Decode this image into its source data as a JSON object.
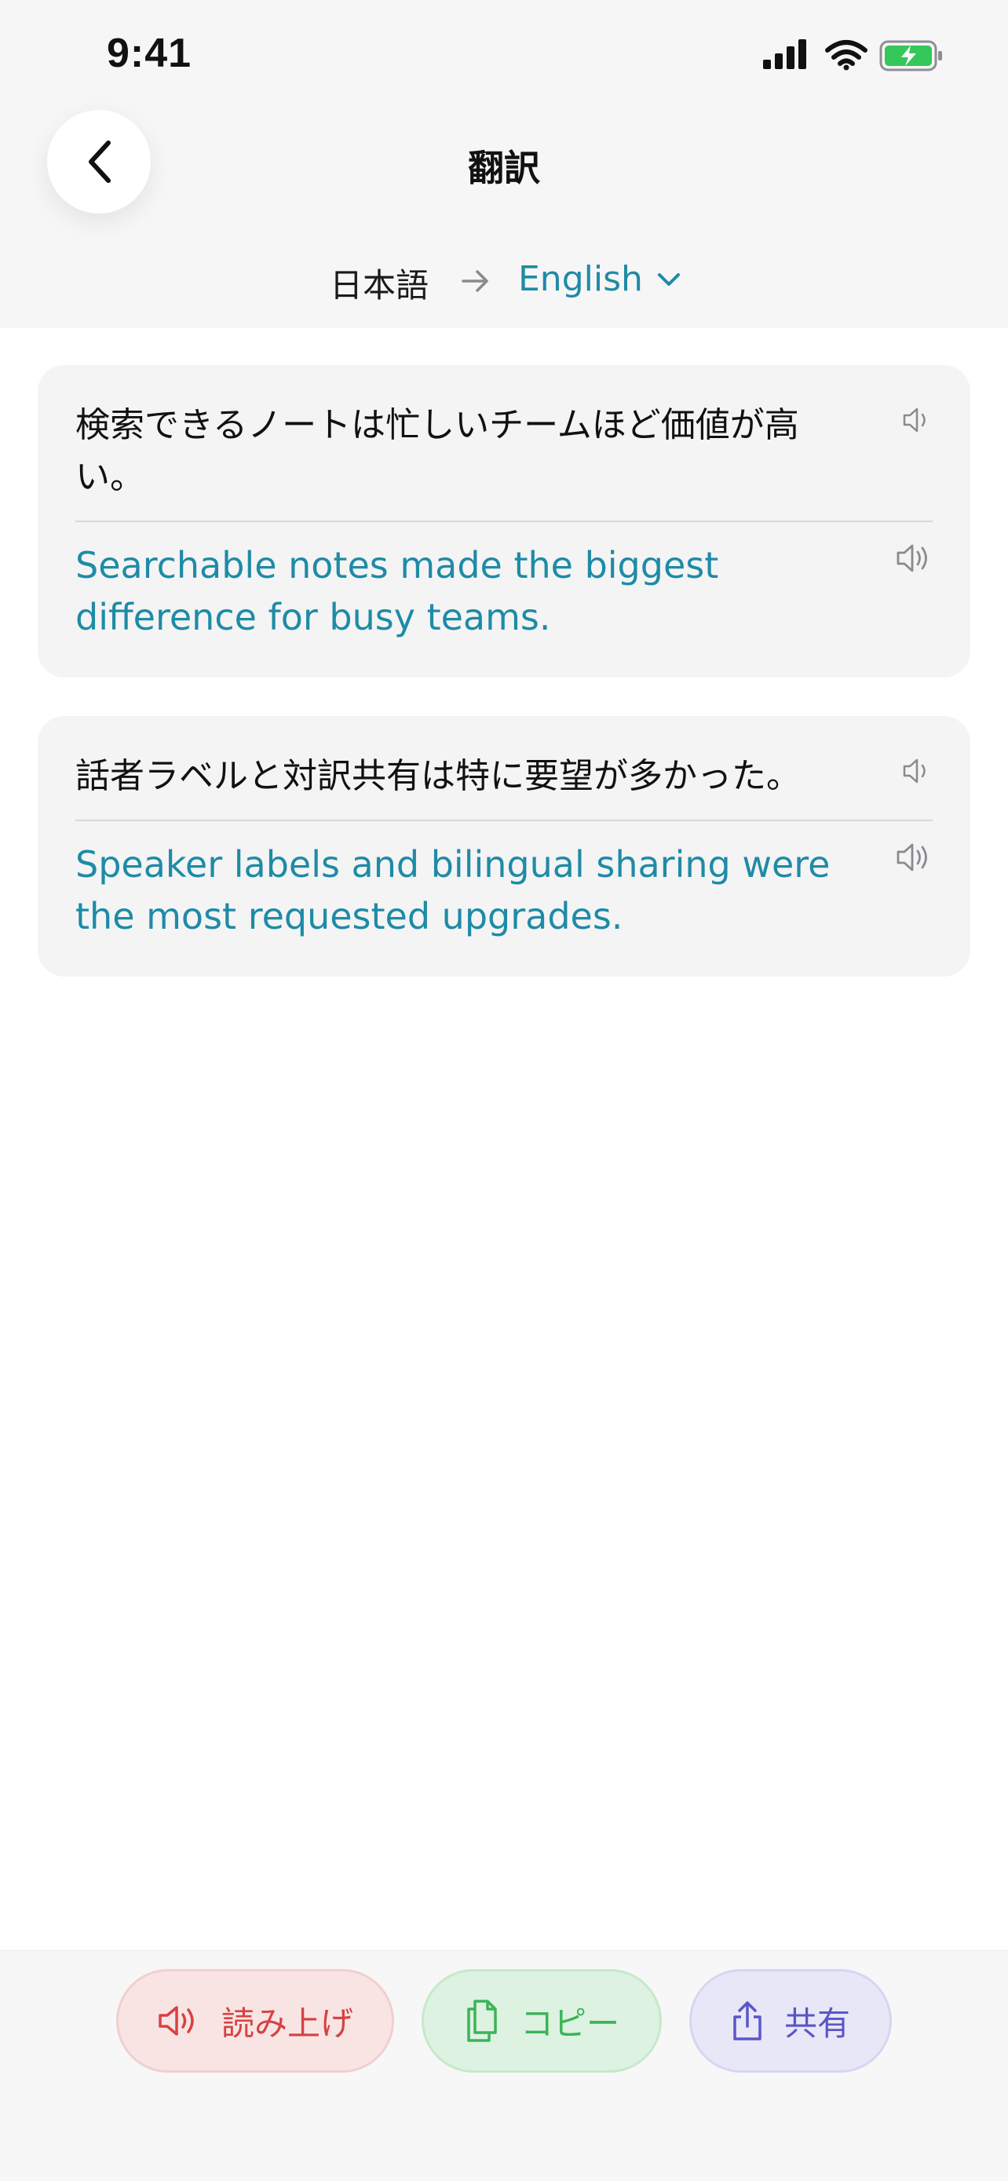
{
  "status_bar": {
    "time": "9:41"
  },
  "header": {
    "title": "翻訳",
    "source_language": "日本語",
    "target_language": "English"
  },
  "translations": [
    {
      "source": "検索できるノートは忙しいチームほど価値が高い。",
      "target": "Searchable notes made the biggest difference for busy teams."
    },
    {
      "source": "話者ラベルと対訳共有は特に要望が多かった。",
      "target": "Speaker labels and bilingual sharing were the most requested upgrades."
    }
  ],
  "actions": {
    "read_aloud": "読み上げ",
    "copy": "コピー",
    "share": "共有"
  },
  "colors": {
    "accent": "#1e8ba6",
    "read_aloud": "#d64242",
    "copy": "#3cb35a",
    "share": "#5b56c6",
    "battery": "#34c759"
  },
  "icons": {
    "back": "chevron-left-icon",
    "arrow": "arrow-right-icon",
    "dropdown": "chevron-down-icon",
    "speaker": "speaker-icon",
    "copy": "copy-icon",
    "share": "share-icon"
  }
}
